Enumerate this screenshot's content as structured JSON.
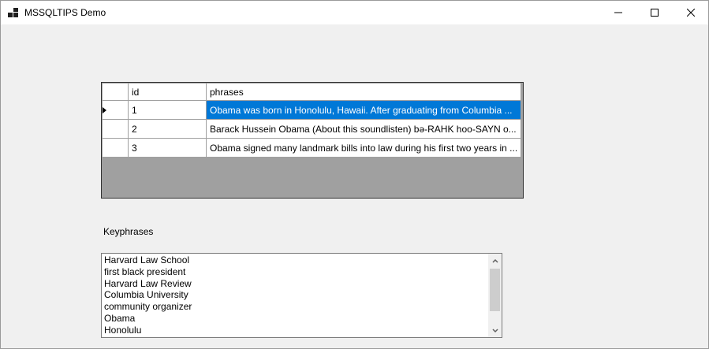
{
  "window": {
    "title": "MSSQLTIPS Demo"
  },
  "grid": {
    "columns": [
      "id",
      "phrases"
    ],
    "rows": [
      {
        "id": "1",
        "phrase": "Obama was born in Honolulu, Hawaii. After graduating from Columbia ...",
        "selected": true
      },
      {
        "id": "2",
        "phrase": "Barack Hussein Obama  (About this soundlisten) bə-RAHK hoo-SAYN o...",
        "selected": false
      },
      {
        "id": "3",
        "phrase": "Obama signed many landmark bills into law during his first two years in ...",
        "selected": false
      }
    ]
  },
  "keyphrases": {
    "label": "Keyphrases",
    "items": [
      "Harvard Law School",
      "first black president",
      "Harvard Law Review",
      "Columbia University",
      "community organizer",
      "Obama",
      "Honolulu"
    ]
  },
  "colors": {
    "selection": "#0078d7",
    "window_bg": "#f0f0f0",
    "grid_bg": "#a0a0a0"
  }
}
